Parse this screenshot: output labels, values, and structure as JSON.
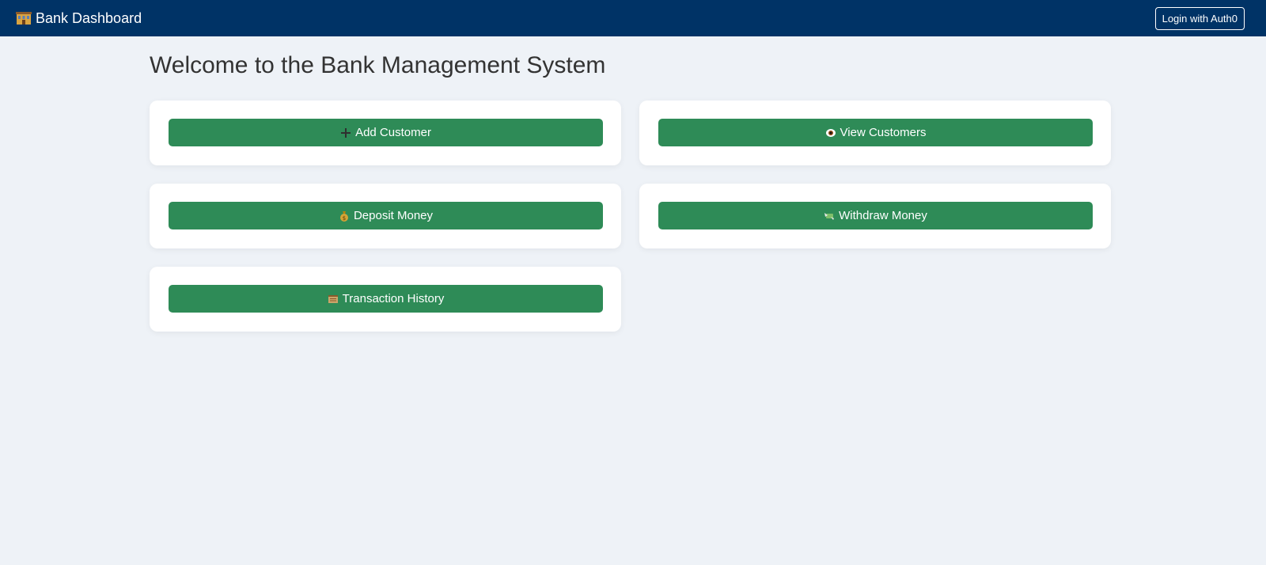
{
  "header": {
    "brand_icon": "bank-building-icon",
    "brand_label": "Bank Dashboard",
    "login_label": "Login with Auth0",
    "background_color": "#003366"
  },
  "main": {
    "title": "Welcome to the Bank Management System",
    "accent_color": "#2e8b57",
    "actions": [
      {
        "icon": "plus-icon",
        "label": "Add Customer"
      },
      {
        "icon": "eye-icon",
        "label": "View Customers"
      },
      {
        "icon": "money-bag-icon",
        "label": "Deposit Money"
      },
      {
        "icon": "money-with-wings-icon",
        "label": "Withdraw Money"
      },
      {
        "icon": "ledger-icon",
        "label": "Transaction History"
      }
    ]
  }
}
